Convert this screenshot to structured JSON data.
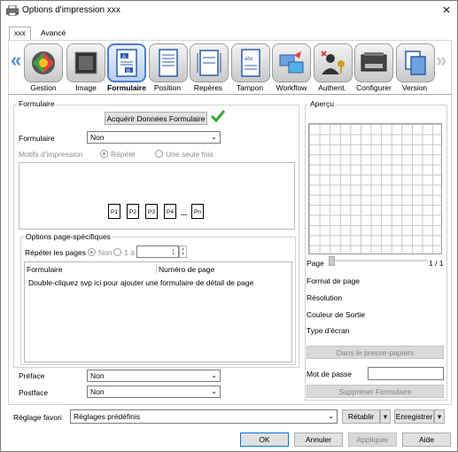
{
  "window": {
    "title": "Options d'impression xxx",
    "close_label": "×"
  },
  "tabs": [
    {
      "label": "xxx",
      "active": true
    },
    {
      "label": "Avancé",
      "active": false
    }
  ],
  "iconbar": {
    "prev_arrow": "«",
    "next_arrow": "»",
    "items": [
      {
        "label": "Gestion",
        "icon": "gestion-icon",
        "selected": false
      },
      {
        "label": "Image",
        "icon": "image-icon",
        "selected": false
      },
      {
        "label": "Formulaire",
        "icon": "formulaire-icon",
        "selected": true
      },
      {
        "label": "Position",
        "icon": "position-icon",
        "selected": false
      },
      {
        "label": "Repères",
        "icon": "reperes-icon",
        "selected": false
      },
      {
        "label": "Tampon",
        "icon": "tampon-icon",
        "selected": false
      },
      {
        "label": "Workflow",
        "icon": "workflow-icon",
        "selected": false
      },
      {
        "label": "Authent.",
        "icon": "authent-icon",
        "selected": false
      },
      {
        "label": "Configurer",
        "icon": "configurer-icon",
        "selected": false
      },
      {
        "label": "Version",
        "icon": "version-icon",
        "selected": false
      }
    ]
  },
  "formulaire": {
    "group_title": "Formulaire",
    "acquire_button": "Acquérir Données Formulaire",
    "form_label": "Formulaire",
    "form_value": "Non",
    "motifs_label": "Motifs d'impression",
    "motif_repete": "Répété",
    "motif_seule": "Une seule fois",
    "pages": [
      "P1",
      "P2",
      "P3",
      "P4",
      "...",
      "Pn"
    ]
  },
  "page_options": {
    "group_title": "Options page-spécifiques",
    "repeat_label": "Répéter les pages",
    "non_label": "Non",
    "one_to_label": "1 à",
    "one_to_value": "1",
    "columns": [
      "Formulaire",
      "Numéro de page"
    ],
    "hint": "Double-cliquez svp ici pour ajouter une formulaire de détail de page"
  },
  "preface": {
    "label": "Préface",
    "value": "Non"
  },
  "postface": {
    "label": "Postface",
    "value": "Non"
  },
  "apercu": {
    "group_title": "Aperçu",
    "page_label": "Page",
    "page_counter": "1 / 1",
    "format_label": "Format de page",
    "resolution_label": "Résolution",
    "couleur_label": "Couleur de Sortie",
    "ecran_label": "Type d'écran",
    "clipboard_button": "Dans le presse-papiers",
    "password_label": "Mot de passe",
    "password_value": "",
    "delete_button": "Supprimer Formulaire"
  },
  "favorites": {
    "label": "Réglage favori",
    "value": "Réglages prédéfinis",
    "reset_button": "Rétablir",
    "save_button": "Enregistrer"
  },
  "footer": {
    "ok": "OK",
    "cancel": "Annuler",
    "apply": "Appliquer",
    "help": "Aide"
  },
  "colors": {
    "accent": "#0078d7",
    "arrow": "#5b8ed6",
    "check": "#3aa53a"
  }
}
